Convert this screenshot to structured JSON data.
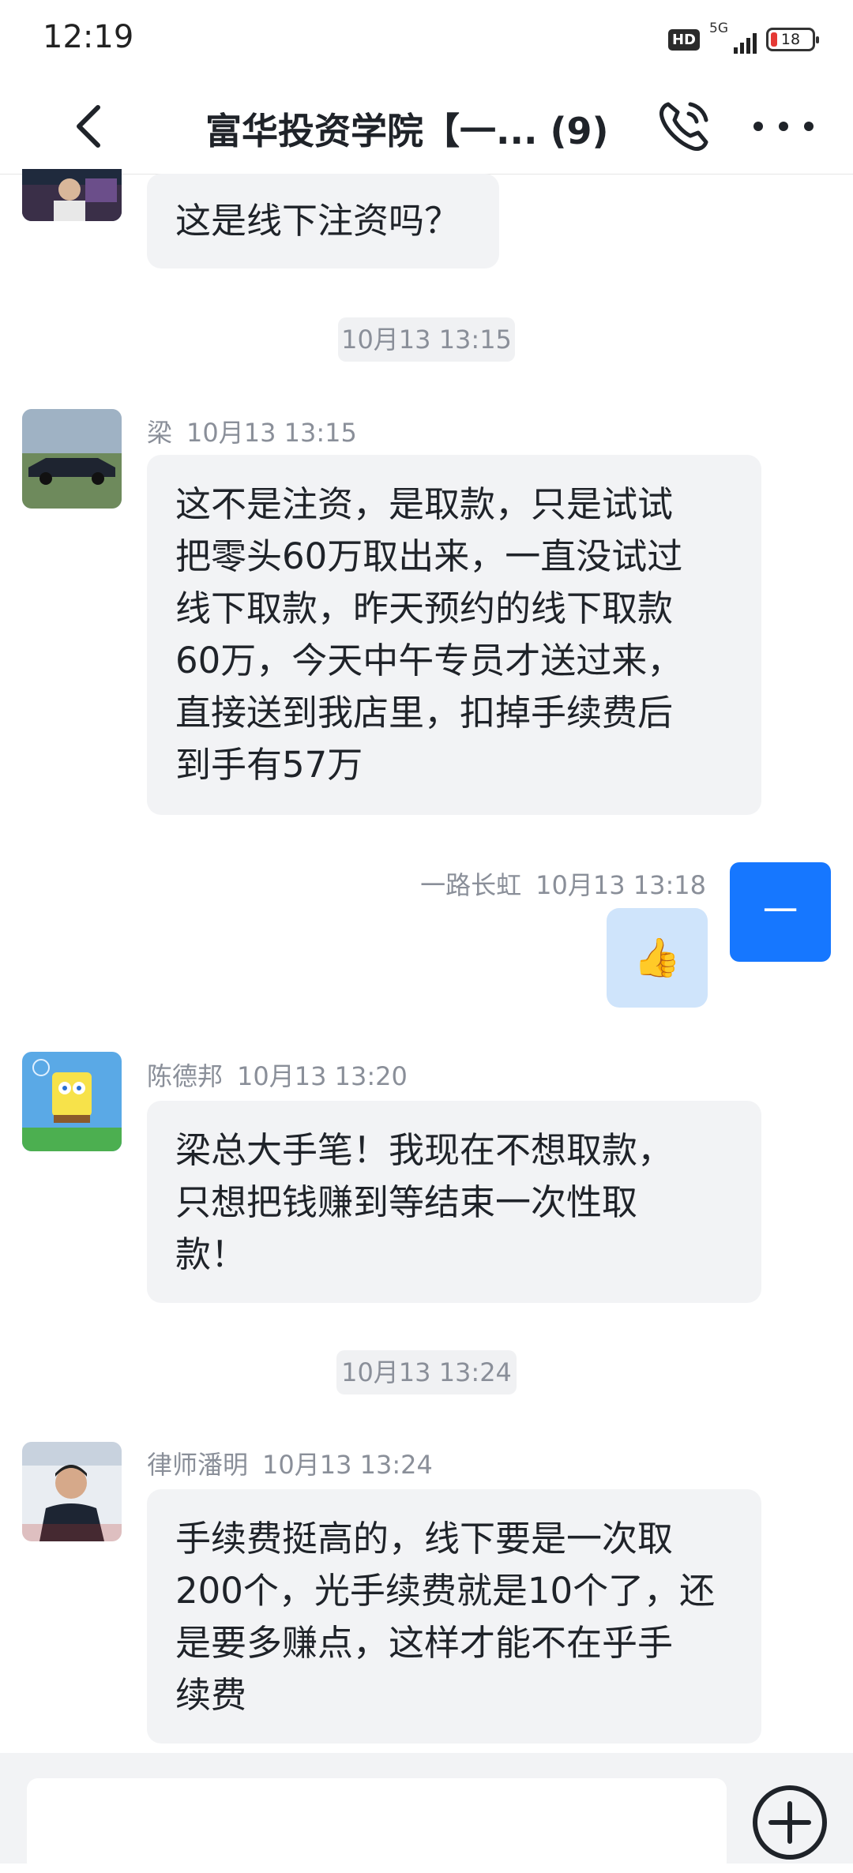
{
  "status_bar": {
    "time": "12:19",
    "hd": "HD",
    "network": "5G",
    "battery": "18"
  },
  "nav": {
    "title": "富华投资学院【一... (9)"
  },
  "messages": [
    {
      "text_lines": [
        "这是线下注资吗？"
      ]
    },
    {
      "divider": "10月13 13:15"
    },
    {
      "sender": "梁",
      "time": "10月13 13:15",
      "text_lines": [
        "这不是注资，是取款，只是试试",
        "把零头60万取出来，一直没试过",
        "线下取款，昨天预约的线下取款",
        "60万，今天中午专员才送过来，",
        "直接送到我店里，扣掉手续费后",
        "到手有57万"
      ]
    },
    {
      "sender": "一路长虹",
      "time": "10月13 13:18",
      "avatar_text": "一",
      "emoji": "👍"
    },
    {
      "sender": "陈德邦",
      "time": "10月13 13:20",
      "text_lines": [
        "梁总大手笔！我现在不想取款，",
        "只想把钱赚到等结束一次性取",
        "款！"
      ]
    },
    {
      "divider": "10月13 13:24"
    },
    {
      "sender": "律师潘明",
      "time": "10月13 13:24",
      "text_lines": [
        "手续费挺高的，线下要是一次取",
        "200个，光手续费就是10个了，还",
        "是要多赚点，这样才能不在乎手",
        "续费"
      ]
    }
  ],
  "colors": {
    "accent": "#1677ff",
    "bubble_in": "#f2f3f5",
    "bubble_out": "#cfe4fb"
  }
}
